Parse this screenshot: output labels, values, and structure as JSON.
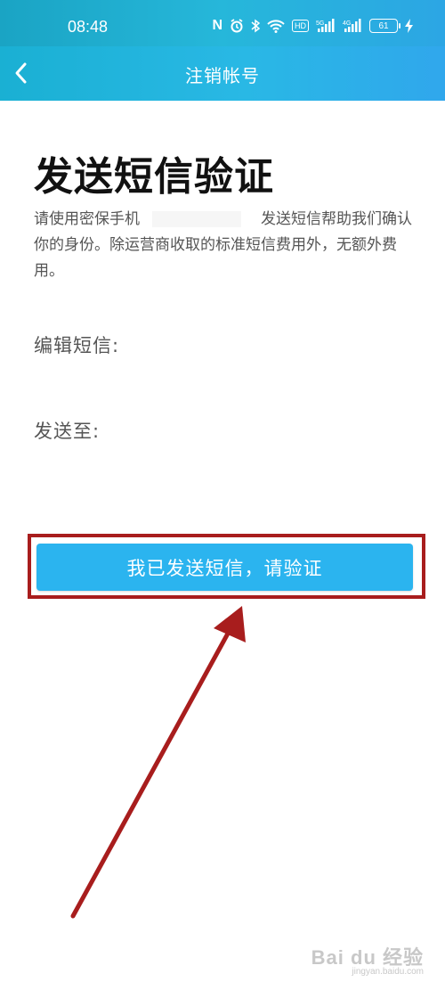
{
  "status_bar": {
    "time": "08:48",
    "icons": [
      "nfc-icon",
      "alarm-icon",
      "bluetooth-icon",
      "wifi-icon",
      "hd-icon",
      "signal-5g-icon",
      "signal-4g-icon",
      "battery-icon",
      "charging-icon"
    ],
    "nfc_label": "N",
    "hd_label": "HD",
    "net1_label": "5G",
    "net2_label": "4G",
    "battery_level": "61"
  },
  "nav": {
    "title": "注销帐号",
    "back_icon": "chevron-left-icon"
  },
  "main": {
    "title": "发送短信验证",
    "desc_before": "请使用密保手机",
    "desc_after": "发送短信帮助我们确认你的身份。除运营商收取的标准短信费用外，无额外费用。",
    "edit_label": "编辑短信:",
    "sendto_label": "发送至:",
    "verify_button_label": "我已发送短信，请验证"
  },
  "colors": {
    "header_gradient_start": "#1aa4c4",
    "header_gradient_end": "#30a7ec",
    "button": "#2bb4ef",
    "annotation_red": "#a81d1d"
  },
  "watermark": {
    "main": "Bai du 经验",
    "sub": "jingyan.baidu.com"
  }
}
